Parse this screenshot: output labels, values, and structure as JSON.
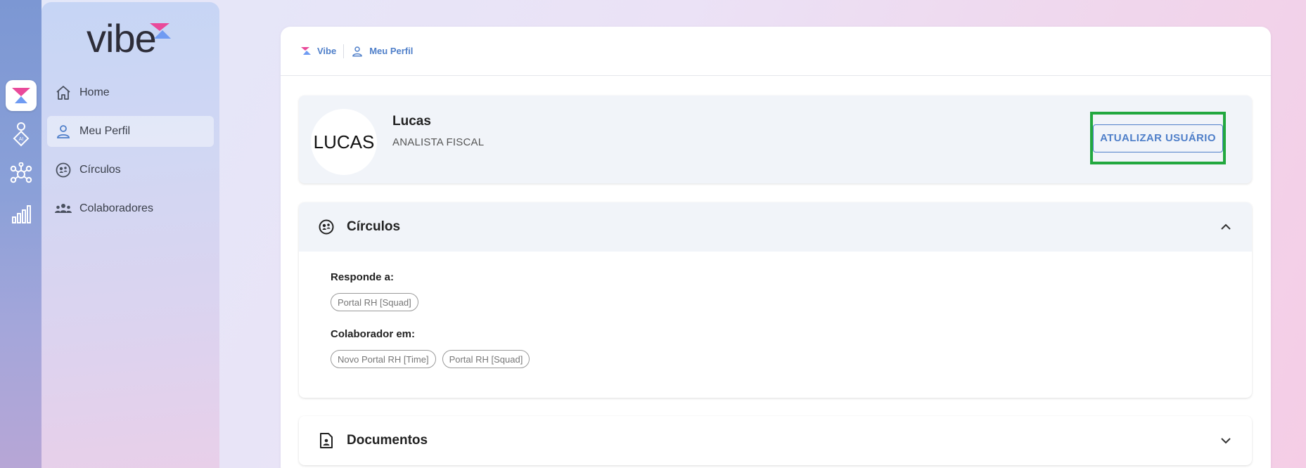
{
  "brand": {
    "logo_text": "vibe",
    "accent_pink": "#e94a9a",
    "accent_blue": "#6f9bf2"
  },
  "rail": {
    "items": [
      {
        "icon": "vibe-logo-icon",
        "active": true
      },
      {
        "icon": "ai-person-icon",
        "active": false
      },
      {
        "icon": "network-icon",
        "active": false
      },
      {
        "icon": "bar-chart-icon",
        "active": false
      }
    ]
  },
  "sidebar": {
    "items": [
      {
        "label": "Home",
        "icon": "home-icon"
      },
      {
        "label": "Meu Perfil",
        "icon": "person-icon",
        "active": true
      },
      {
        "label": "Círculos",
        "icon": "circles-icon"
      },
      {
        "label": "Colaboradores",
        "icon": "group-icon"
      }
    ]
  },
  "breadcrumb": {
    "root": "Vibe",
    "current": "Meu Perfil"
  },
  "profile": {
    "avatar_text": "LUCAS",
    "name": "Lucas",
    "role": "ANALISTA FISCAL",
    "update_button": "ATUALIZAR USUÁRIO"
  },
  "circulos": {
    "title": "Círculos",
    "responde_label": "Responde a:",
    "responde_chips": [
      "Portal RH [Squad]"
    ],
    "colaborador_label": "Colaborador em:",
    "colaborador_chips": [
      "Novo Portal RH [Time]",
      "Portal RH [Squad]"
    ]
  },
  "documentos": {
    "title": "Documentos"
  }
}
